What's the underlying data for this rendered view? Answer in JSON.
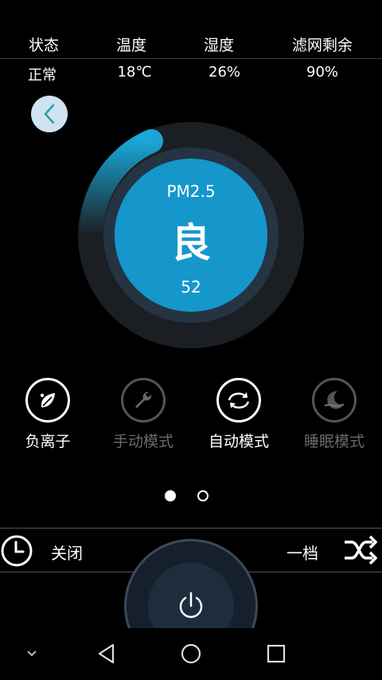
{
  "status": {
    "labels": [
      "状态",
      "温度",
      "湿度",
      "滤网剩余"
    ],
    "values": [
      "正常",
      "18℃",
      "26%",
      "90%"
    ]
  },
  "gauge": {
    "metric_label": "PM2.5",
    "level": "良",
    "value": "52",
    "accent": "#1a9bd0"
  },
  "modes": [
    {
      "label": "负离子",
      "active": true,
      "icon": "leaf-icon"
    },
    {
      "label": "手动模式",
      "active": false,
      "icon": "wrench-icon"
    },
    {
      "label": "自动模式",
      "active": true,
      "icon": "auto-cycle-icon"
    },
    {
      "label": "睡眠模式",
      "active": false,
      "icon": "moon-icon"
    }
  ],
  "pager": {
    "count": 2,
    "current": 1
  },
  "controls": {
    "timer_label": "关闭",
    "speed_label": "一档"
  },
  "icons": {
    "back": "chevron-left-icon",
    "timer": "clock-icon",
    "shuffle": "shuffle-icon",
    "power": "power-icon"
  }
}
